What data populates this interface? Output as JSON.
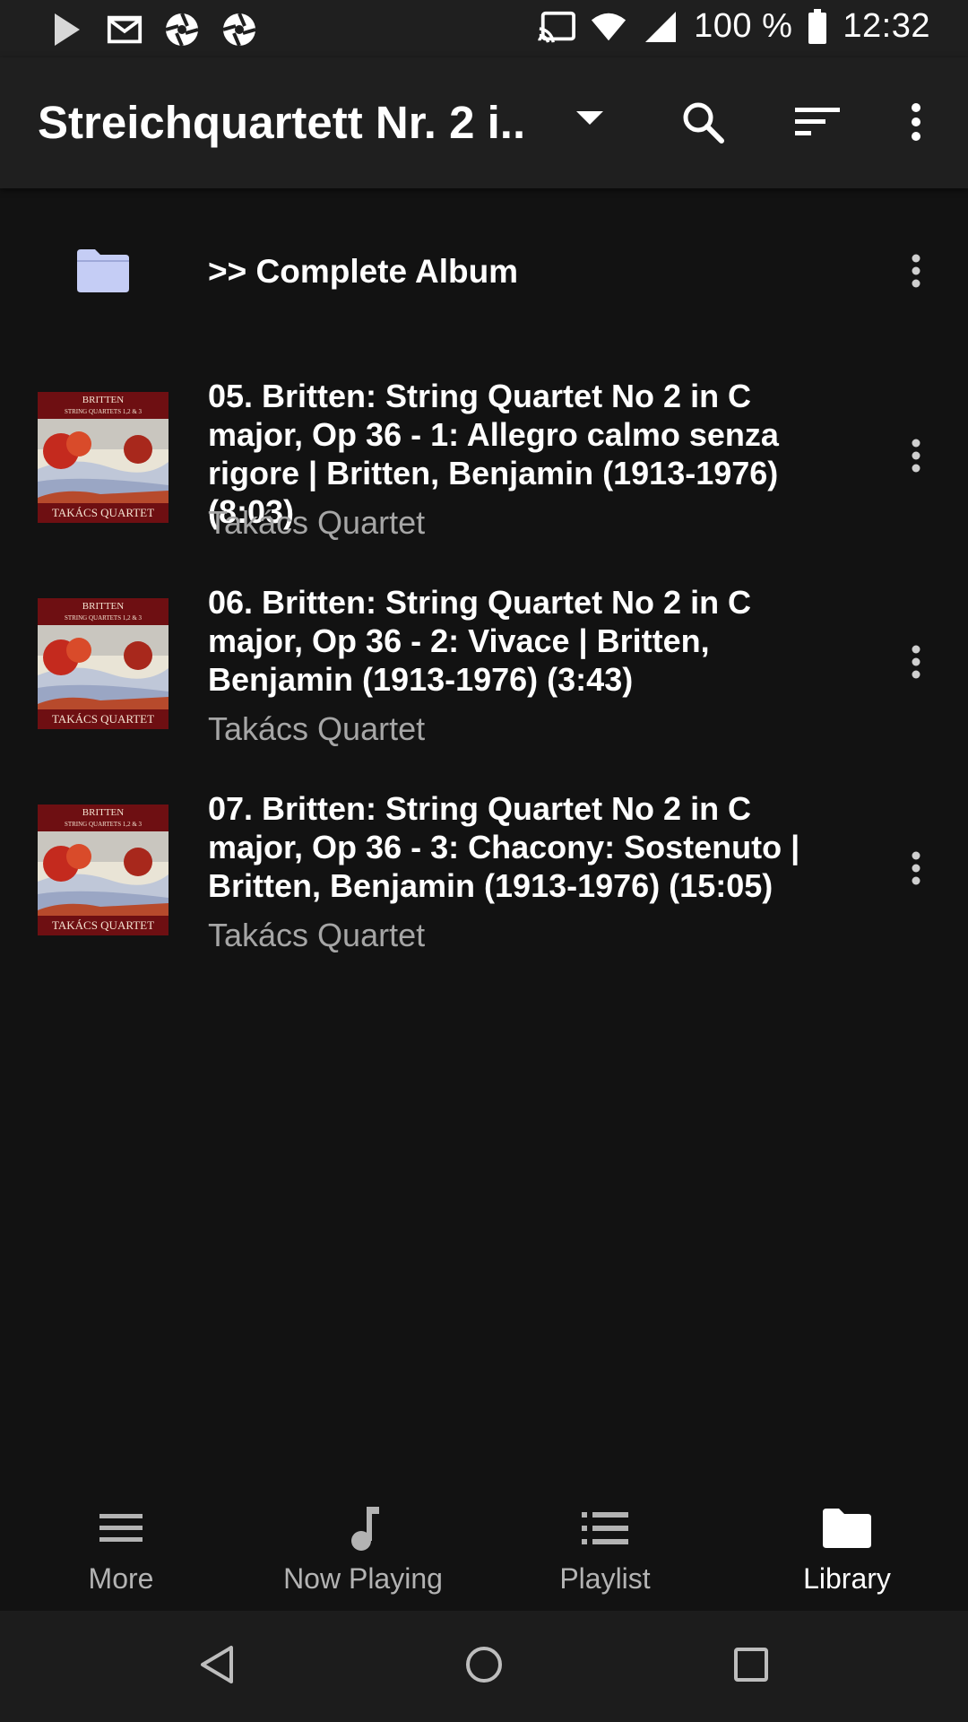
{
  "status_bar": {
    "battery_text": "100 %",
    "time": "12:32",
    "left_icons": [
      "play-store-icon",
      "gmail-icon",
      "aperture-icon",
      "aperture-icon"
    ],
    "right_icons": [
      "cast-icon",
      "wifi-icon",
      "signal-icon",
      "battery-icon"
    ]
  },
  "app_bar": {
    "title": "Streichquartett Nr. 2 i..",
    "icons": [
      "dropdown-arrow-icon",
      "search-icon",
      "sort-icon",
      "overflow-menu-icon"
    ]
  },
  "folder_row": {
    "label": ">> Complete Album",
    "icon": "folder-icon"
  },
  "cover_art": {
    "top_line": "BRITTEN",
    "sub_line": "STRING QUARTETS 1,2 & 3",
    "bottom_line": "TAKÁCS QUARTET"
  },
  "tracks": [
    {
      "title": "05. Britten: String Quartet No 2 in C major, Op 36 - 1: Allegro calmo senza rigore | Britten, Benjamin (1913-1976) (8:03)",
      "artist": "Takács Quartet"
    },
    {
      "title": "06. Britten: String Quartet No 2 in C major, Op 36 - 2: Vivace | Britten, Benjamin (1913-1976) (3:43)",
      "artist": "Takács Quartet"
    },
    {
      "title": "07. Britten: String Quartet No 2 in C major, Op 36 - 3: Chacony: Sostenuto | Britten, Benjamin (1913-1976) (15:05)",
      "artist": "Takács Quartet"
    }
  ],
  "bottom_nav": {
    "items": [
      {
        "label": "More",
        "icon": "hamburger-icon",
        "active": false
      },
      {
        "label": "Now Playing",
        "icon": "music-note-icon",
        "active": false
      },
      {
        "label": "Playlist",
        "icon": "list-icon",
        "active": false
      },
      {
        "label": "Library",
        "icon": "folder-icon",
        "active": true
      }
    ]
  },
  "system_nav": {
    "icons": [
      "back-icon",
      "home-icon",
      "recents-icon"
    ]
  },
  "colors": {
    "background": "#121212",
    "bars": "#1f1f1f",
    "primary_text": "#ffffff",
    "secondary_text": "#a6a6a6",
    "folder_accent": "#c5cdf5",
    "cover_red": "#6e0f12"
  }
}
